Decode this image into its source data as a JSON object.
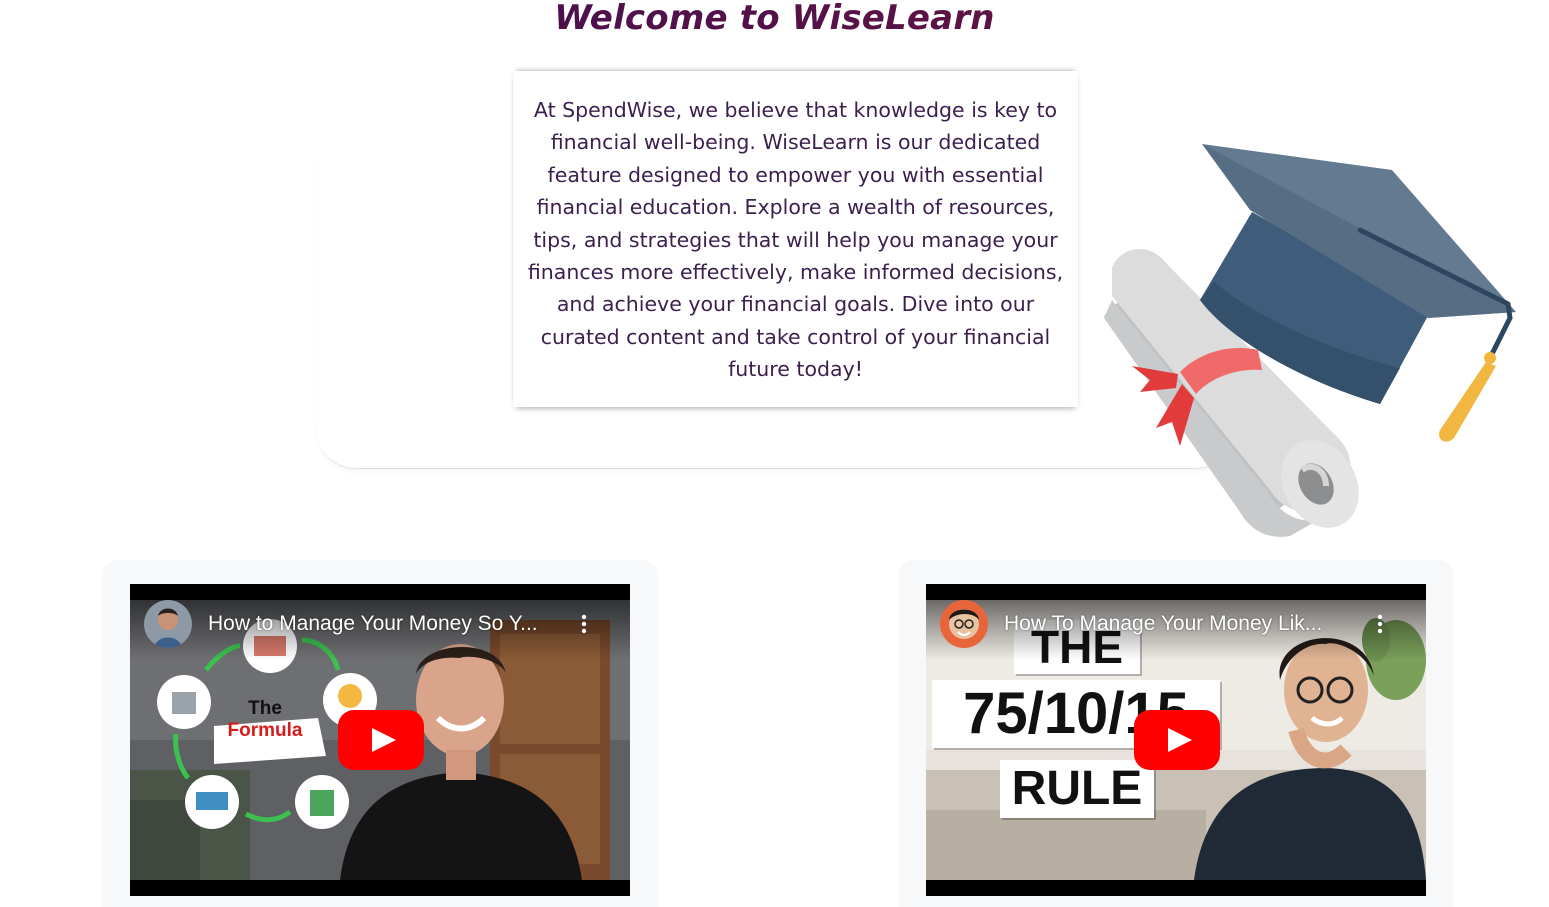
{
  "header": {
    "title": "Welcome to WiseLearn"
  },
  "intro": {
    "text": "At SpendWise, we believe that knowledge is key to financial well-being. WiseLearn is our dedicated feature designed to empower you with essential financial education. Explore a wealth of resources, tips, and strategies that will help you manage your finances more effectively, make informed decisions, and achieve your financial goals. Dive into our curated content and take control of your financial future today!"
  },
  "videos": [
    {
      "title": "How to Manage Your Money So Y...",
      "thumbnail_text": {
        "line1": "The",
        "line2": "Formula"
      }
    },
    {
      "title": "How To Manage Your Money Lik...",
      "thumbnail_text": {
        "line1": "THE",
        "line2": "75/10/15",
        "line3": "RULE"
      }
    }
  ],
  "colors": {
    "title_start": "#3a0e57",
    "title_end": "#7a1630",
    "body_text": "#3b1f4e",
    "play_red": "#ff0000",
    "card_bg": "#f7f8fa"
  },
  "icons": [
    "graduation-cap-icon",
    "diploma-scroll-icon",
    "youtube-play-icon",
    "more-vertical-icon"
  ]
}
